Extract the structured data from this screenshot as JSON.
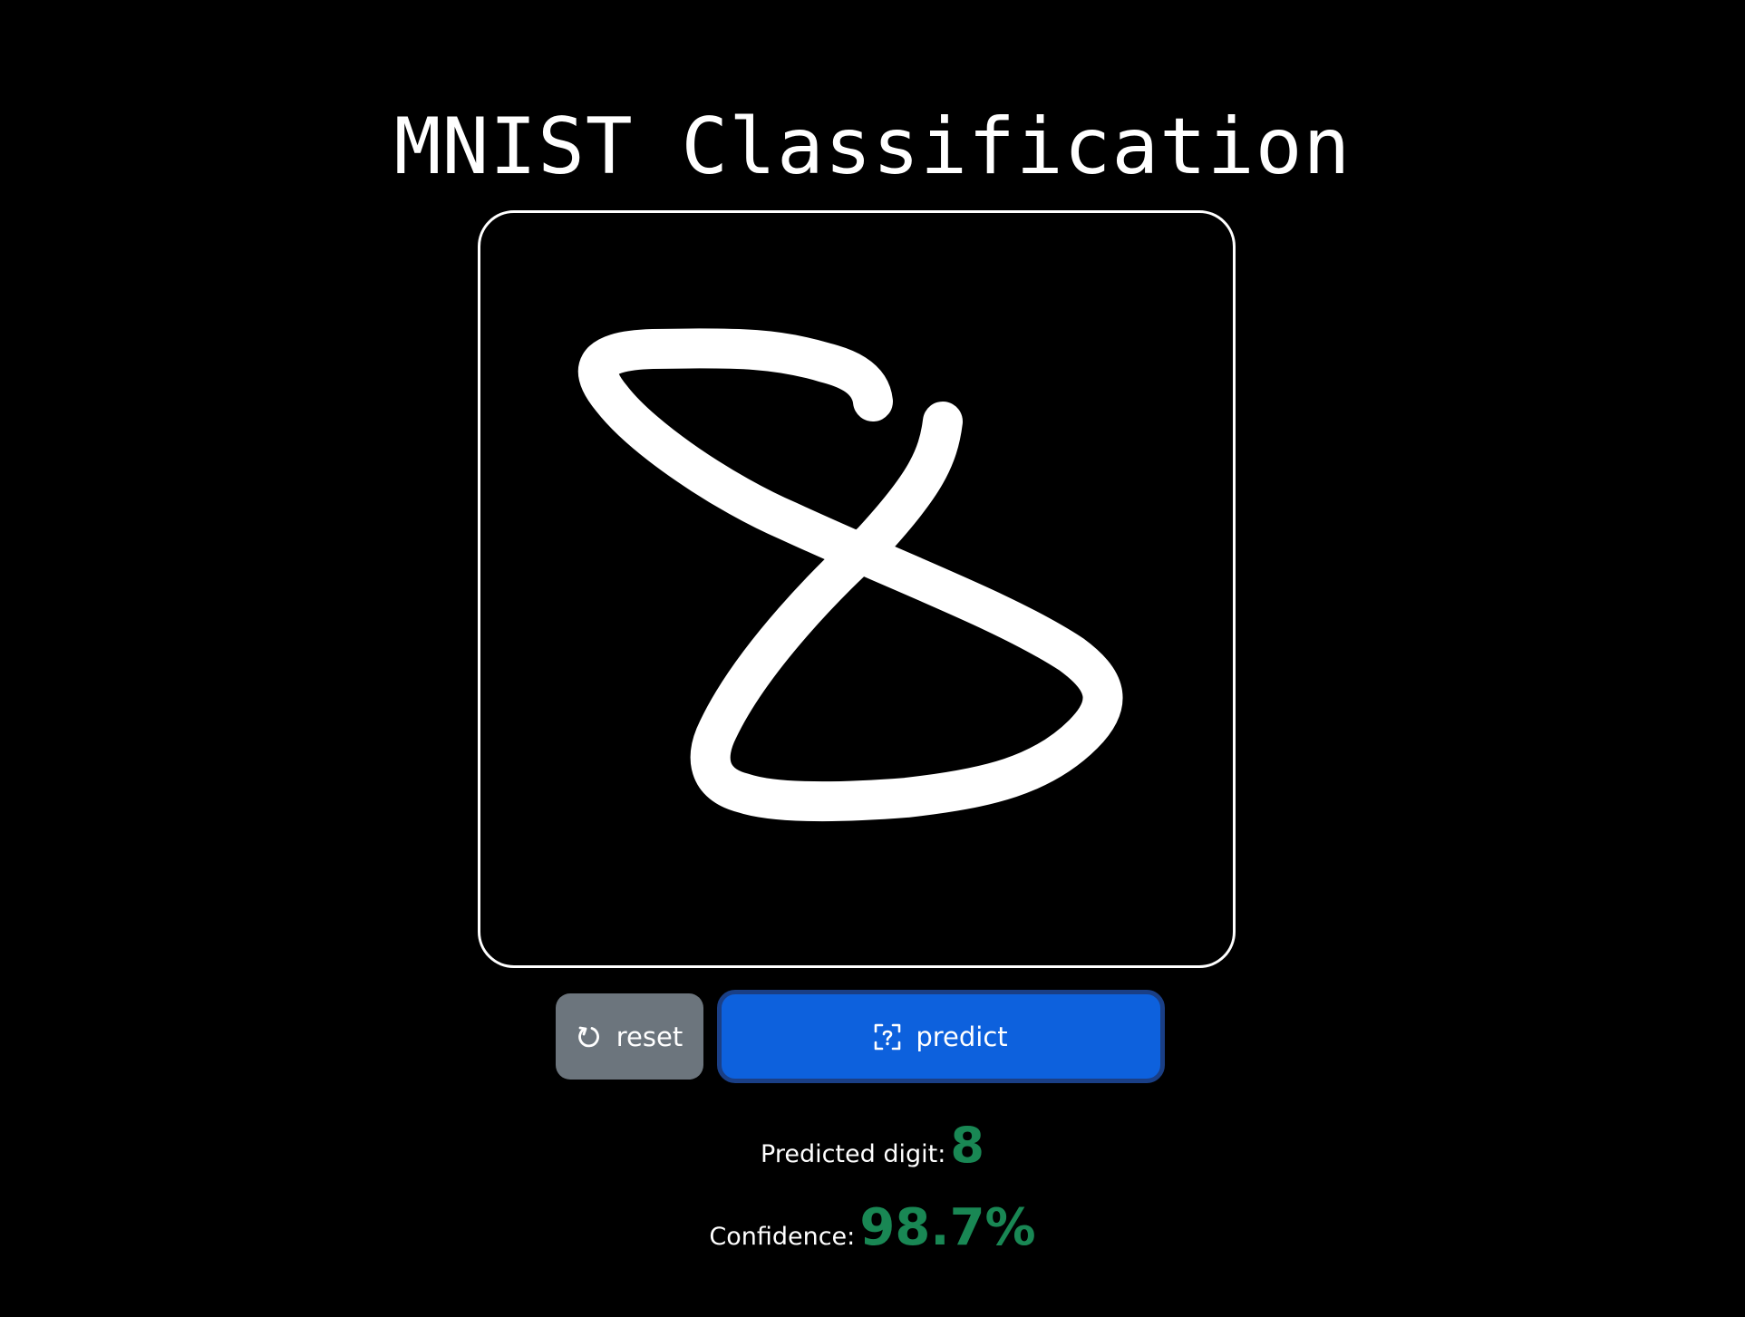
{
  "page": {
    "title": "MNIST Classification"
  },
  "canvas": {
    "stroke_color": "#ffffff",
    "background_color": "#000000",
    "border_color": "#ffffff"
  },
  "buttons": {
    "reset": {
      "label": "reset",
      "icon": "refresh-icon",
      "color": "#6c757d"
    },
    "predict": {
      "label": "predict",
      "icon": "scan-question-icon",
      "color": "#0d61dd"
    }
  },
  "result": {
    "digit_label": "Predicted digit:",
    "digit_value": "8",
    "confidence_label": "Confidence:",
    "confidence_value": "98.7%",
    "value_color": "#198754"
  }
}
